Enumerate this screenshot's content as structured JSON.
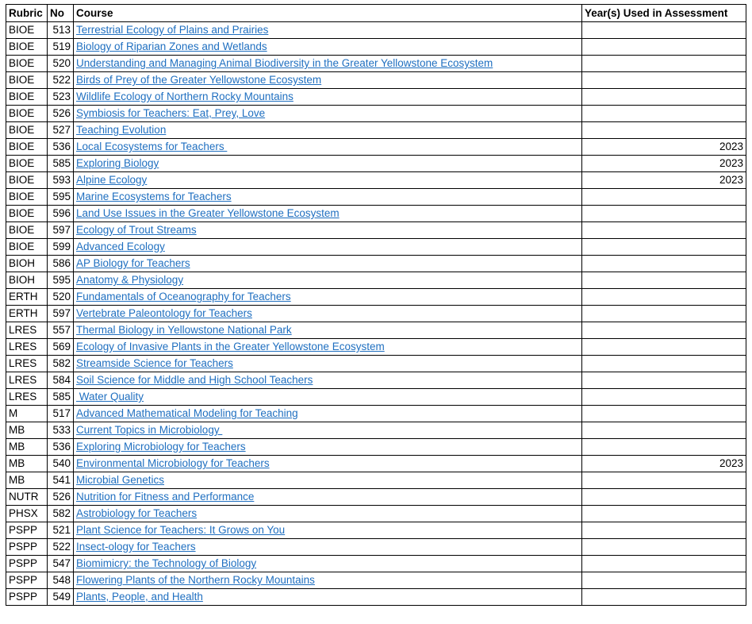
{
  "table": {
    "columns": [
      {
        "key": "rubric",
        "label": "Rubric"
      },
      {
        "key": "no",
        "label": "No"
      },
      {
        "key": "course",
        "label": "Course"
      },
      {
        "key": "years",
        "label": "Year(s) Used in Assessment"
      }
    ],
    "link_color": "#1F6FC0",
    "rows": [
      {
        "rubric": "BIOE",
        "no": "513",
        "course": "Terrestrial Ecology of Plains and Prairies",
        "years": ""
      },
      {
        "rubric": "BIOE",
        "no": "519",
        "course": "Biology of Riparian Zones and Wetlands",
        "years": ""
      },
      {
        "rubric": "BIOE",
        "no": "520",
        "course": "Understanding and Managing Animal Biodiversity in the Greater Yellowstone Ecosystem",
        "years": ""
      },
      {
        "rubric": "BIOE",
        "no": "522",
        "course": "Birds of Prey of the Greater Yellowstone Ecosystem",
        "years": ""
      },
      {
        "rubric": "BIOE",
        "no": "523",
        "course": "Wildlife Ecology of Northern Rocky Mountains",
        "years": ""
      },
      {
        "rubric": "BIOE",
        "no": "526",
        "course": "Symbiosis for Teachers: Eat, Prey, Love",
        "years": ""
      },
      {
        "rubric": "BIOE",
        "no": "527",
        "course": "Teaching Evolution",
        "years": ""
      },
      {
        "rubric": "BIOE",
        "no": "536",
        "course": "Local Ecosystems for Teachers ",
        "years": "2023"
      },
      {
        "rubric": "BIOE",
        "no": "585",
        "course": "Exploring Biology",
        "years": "2023"
      },
      {
        "rubric": "BIOE",
        "no": "593",
        "course": "Alpine Ecology",
        "years": "2023"
      },
      {
        "rubric": "BIOE",
        "no": "595",
        "course": "Marine Ecosystems for Teachers",
        "years": ""
      },
      {
        "rubric": "BIOE",
        "no": "596",
        "course": "Land Use Issues in the Greater Yellowstone Ecosystem",
        "years": ""
      },
      {
        "rubric": "BIOE",
        "no": "597",
        "course": "Ecology of Trout Streams",
        "years": ""
      },
      {
        "rubric": "BIOE",
        "no": "599",
        "course": "Advanced Ecology",
        "years": ""
      },
      {
        "rubric": "BIOH",
        "no": "586",
        "course": "AP Biology for Teachers",
        "years": ""
      },
      {
        "rubric": "BIOH",
        "no": "595",
        "course": "Anatomy & Physiology",
        "years": ""
      },
      {
        "rubric": "ERTH",
        "no": "520",
        "course": "Fundamentals of Oceanography for Teachers",
        "years": ""
      },
      {
        "rubric": "ERTH",
        "no": "597",
        "course": "Vertebrate Paleontology for Teachers",
        "years": ""
      },
      {
        "rubric": "LRES",
        "no": "557",
        "course": "Thermal Biology in Yellowstone National Park",
        "years": ""
      },
      {
        "rubric": "LRES",
        "no": "569",
        "course": "Ecology of Invasive Plants in the Greater Yellowstone Ecosystem",
        "years": ""
      },
      {
        "rubric": "LRES",
        "no": "582",
        "course": "Streamside Science for Teachers",
        "years": ""
      },
      {
        "rubric": "LRES",
        "no": "584",
        "course": "Soil Science for Middle and High School Teachers",
        "years": ""
      },
      {
        "rubric": "LRES",
        "no": "585",
        "course": " Water Quality",
        "years": ""
      },
      {
        "rubric": "M",
        "no": "517",
        "course": "Advanced Mathematical Modeling for Teaching",
        "years": ""
      },
      {
        "rubric": "MB",
        "no": "533",
        "course": "Current Topics in Microbiology ",
        "years": ""
      },
      {
        "rubric": "MB",
        "no": "536",
        "course": "Exploring Microbiology for Teachers",
        "years": ""
      },
      {
        "rubric": "MB",
        "no": "540",
        "course": "Environmental Microbiology for Teachers",
        "years": "2023"
      },
      {
        "rubric": "MB",
        "no": "541",
        "course": "Microbial Genetics",
        "years": ""
      },
      {
        "rubric": "NUTR",
        "no": "526",
        "course": "Nutrition for Fitness and Performance",
        "years": ""
      },
      {
        "rubric": "PHSX",
        "no": "582",
        "course": "Astrobiology for Teachers",
        "years": ""
      },
      {
        "rubric": "PSPP",
        "no": "521",
        "course": "Plant Science for Teachers: It Grows on You",
        "years": ""
      },
      {
        "rubric": "PSPP",
        "no": "522",
        "course": "Insect-ology for Teachers",
        "years": ""
      },
      {
        "rubric": "PSPP",
        "no": "547",
        "course": "Biomimicry: the Technology of Biology",
        "years": ""
      },
      {
        "rubric": "PSPP",
        "no": "548",
        "course": "Flowering Plants of the Northern Rocky Mountains",
        "years": ""
      },
      {
        "rubric": "PSPP",
        "no": "549",
        "course": "Plants, People, and Health",
        "years": ""
      }
    ]
  }
}
